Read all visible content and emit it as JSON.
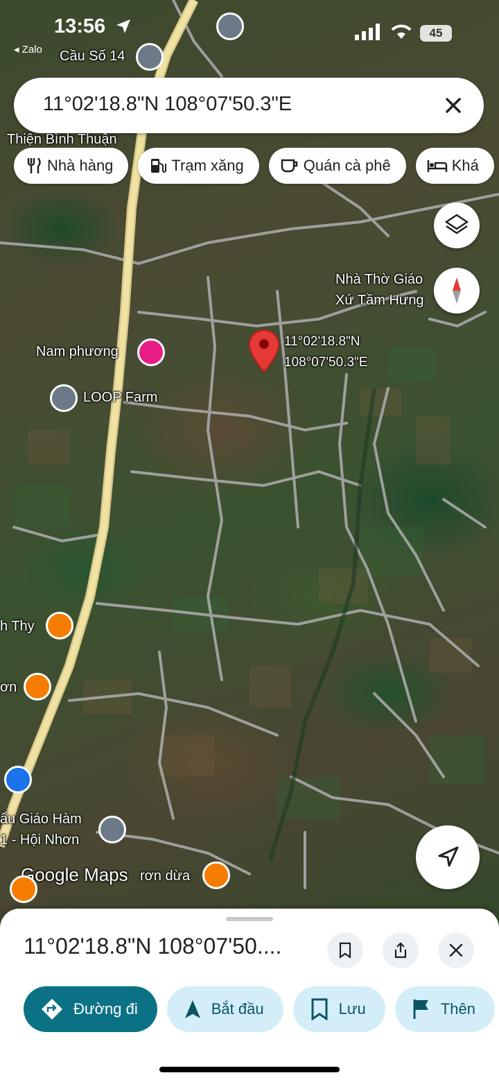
{
  "status_bar": {
    "time": "13:56",
    "back_app": "◂ Zalo",
    "battery": "45"
  },
  "search": {
    "query": "11°02'18.8\"N 108°07'50.3\"E"
  },
  "chips": [
    {
      "label": "Nhà hàng",
      "icon": "restaurant-icon"
    },
    {
      "label": "Trạm xăng",
      "icon": "gas-station-icon"
    },
    {
      "label": "Quán cà phê",
      "icon": "coffee-icon"
    },
    {
      "label": "Khá",
      "icon": "hotel-icon"
    }
  ],
  "map": {
    "labels": {
      "cau_so_14": "Cầu Số 14",
      "thien_binh_thuan": "Thiện Bình Thuận",
      "nha_tho_line1": "Nhà Thờ Giáo",
      "nha_tho_line2": "Xứ Tầm Hưng",
      "nam_phuong": "Nam phương",
      "loop_farm": "LOOP Farm",
      "thy": "h Thy",
      "on": "ơn",
      "giao_ham": "ẩu Giáo Hàm",
      "hoi_nhon": "1 - Hội Nhơn",
      "dua": "rơn dừa",
      "pin_lat": "11°02'18.8\"N",
      "pin_lng": "108°07'50.3\"E",
      "google_maps": "Google Maps"
    },
    "colors": {
      "road_main": "#efe2a2",
      "road_minor": "#a9a9a9",
      "pin": "#e53935",
      "poi_orange": "#f57c00",
      "poi_pink": "#e91e84",
      "poi_gray": "#6b7a86",
      "poi_blue": "#1a73e8"
    }
  },
  "sheet": {
    "title": "11°02'18.8\"N 108°07'50....",
    "actions": [
      {
        "label": "Đường đi",
        "icon": "directions-icon"
      },
      {
        "label": "Bắt đầu",
        "icon": "navigation-icon"
      },
      {
        "label": "Lưu",
        "icon": "bookmark-icon"
      },
      {
        "label": "Thên",
        "icon": "flag-icon"
      }
    ]
  }
}
